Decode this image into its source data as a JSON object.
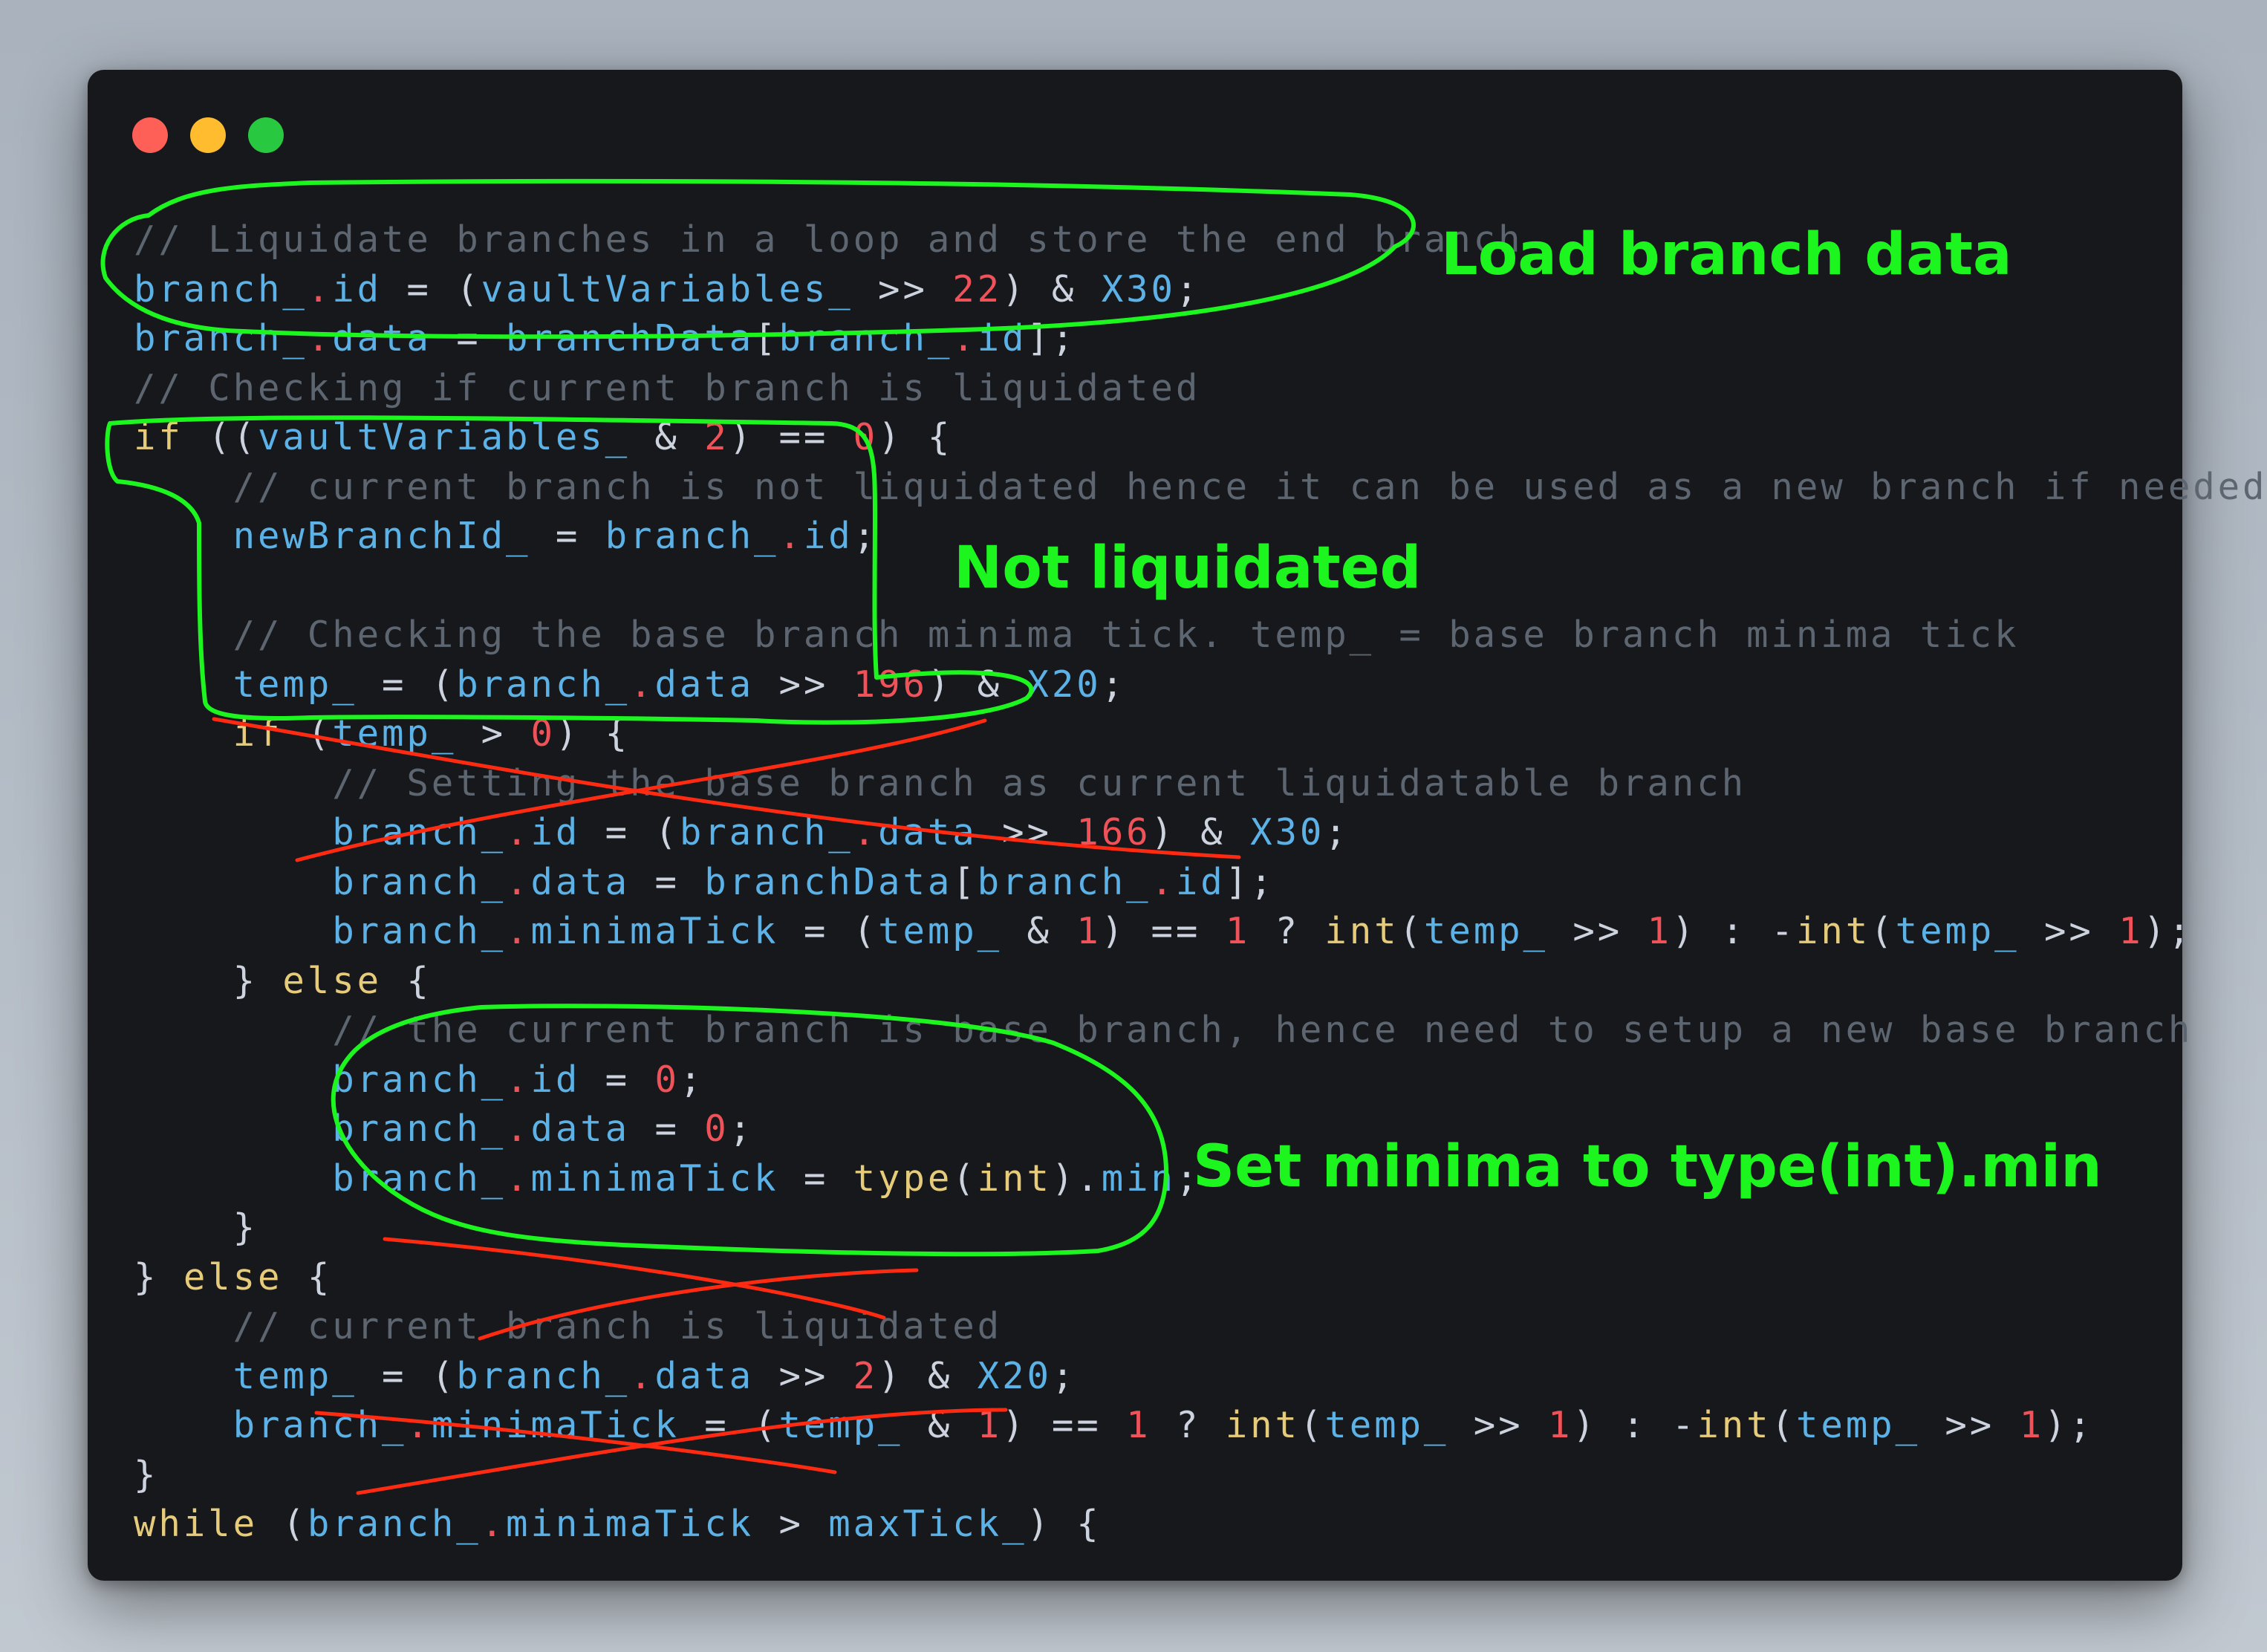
{
  "window": {
    "controls": [
      "close",
      "minimize",
      "maximize"
    ],
    "colors": {
      "close": "#fe5f57",
      "minimize": "#febc2e",
      "maximize": "#28c840"
    }
  },
  "code_lines": [
    [
      {
        "t": "// Liquidate branches in a loop and store the end branch",
        "c": "cm"
      }
    ],
    [
      {
        "t": "branch_",
        "c": "vr"
      },
      {
        "t": ".",
        "c": "nm"
      },
      {
        "t": "id",
        "c": "vr"
      },
      {
        "t": " = (",
        "c": "op"
      },
      {
        "t": "vaultVariables_",
        "c": "vr"
      },
      {
        "t": " >> ",
        "c": "op"
      },
      {
        "t": "22",
        "c": "nm"
      },
      {
        "t": ") & ",
        "c": "op"
      },
      {
        "t": "X30",
        "c": "vr"
      },
      {
        "t": ";",
        "c": "op"
      }
    ],
    [
      {
        "t": "branch_",
        "c": "vr"
      },
      {
        "t": ".",
        "c": "nm"
      },
      {
        "t": "data",
        "c": "vr"
      },
      {
        "t": " = ",
        "c": "op"
      },
      {
        "t": "branchData",
        "c": "vr"
      },
      {
        "t": "[",
        "c": "op"
      },
      {
        "t": "branch_",
        "c": "vr"
      },
      {
        "t": ".",
        "c": "nm"
      },
      {
        "t": "id",
        "c": "vr"
      },
      {
        "t": "];",
        "c": "op"
      }
    ],
    [
      {
        "t": "// Checking if current branch is liquidated",
        "c": "cm"
      }
    ],
    [
      {
        "t": "if",
        "c": "kw"
      },
      {
        "t": " ((",
        "c": "op"
      },
      {
        "t": "vaultVariables_",
        "c": "vr"
      },
      {
        "t": " & ",
        "c": "op"
      },
      {
        "t": "2",
        "c": "nm"
      },
      {
        "t": ") == ",
        "c": "op"
      },
      {
        "t": "0",
        "c": "nm"
      },
      {
        "t": ") {",
        "c": "op"
      }
    ],
    [
      {
        "t": "    // current branch is not liquidated hence it can be used as a new branch if needed",
        "c": "cm"
      }
    ],
    [
      {
        "t": "    ",
        "c": "op"
      },
      {
        "t": "newBranchId_",
        "c": "vr"
      },
      {
        "t": " = ",
        "c": "op"
      },
      {
        "t": "branch_",
        "c": "vr"
      },
      {
        "t": ".",
        "c": "nm"
      },
      {
        "t": "id",
        "c": "vr"
      },
      {
        "t": ";",
        "c": "op"
      }
    ],
    [
      {
        "t": "",
        "c": "op"
      }
    ],
    [
      {
        "t": "    // Checking the base branch minima tick. temp_ = base branch minima tick",
        "c": "cm"
      }
    ],
    [
      {
        "t": "    ",
        "c": "op"
      },
      {
        "t": "temp_",
        "c": "vr"
      },
      {
        "t": " = (",
        "c": "op"
      },
      {
        "t": "branch_",
        "c": "vr"
      },
      {
        "t": ".",
        "c": "nm"
      },
      {
        "t": "data",
        "c": "vr"
      },
      {
        "t": " >> ",
        "c": "op"
      },
      {
        "t": "196",
        "c": "nm"
      },
      {
        "t": ") & ",
        "c": "op"
      },
      {
        "t": "X20",
        "c": "vr"
      },
      {
        "t": ";",
        "c": "op"
      }
    ],
    [
      {
        "t": "    ",
        "c": "op"
      },
      {
        "t": "if",
        "c": "kw"
      },
      {
        "t": " (",
        "c": "op"
      },
      {
        "t": "temp_",
        "c": "vr"
      },
      {
        "t": " > ",
        "c": "op"
      },
      {
        "t": "0",
        "c": "nm"
      },
      {
        "t": ") {",
        "c": "op"
      }
    ],
    [
      {
        "t": "        // Setting the base branch as current liquidatable branch",
        "c": "cm"
      }
    ],
    [
      {
        "t": "        ",
        "c": "op"
      },
      {
        "t": "branch_",
        "c": "vr"
      },
      {
        "t": ".",
        "c": "nm"
      },
      {
        "t": "id",
        "c": "vr"
      },
      {
        "t": " = (",
        "c": "op"
      },
      {
        "t": "branch_",
        "c": "vr"
      },
      {
        "t": ".",
        "c": "nm"
      },
      {
        "t": "data",
        "c": "vr"
      },
      {
        "t": " >> ",
        "c": "op"
      },
      {
        "t": "166",
        "c": "nm"
      },
      {
        "t": ") & ",
        "c": "op"
      },
      {
        "t": "X30",
        "c": "vr"
      },
      {
        "t": ";",
        "c": "op"
      }
    ],
    [
      {
        "t": "        ",
        "c": "op"
      },
      {
        "t": "branch_",
        "c": "vr"
      },
      {
        "t": ".",
        "c": "nm"
      },
      {
        "t": "data",
        "c": "vr"
      },
      {
        "t": " = ",
        "c": "op"
      },
      {
        "t": "branchData",
        "c": "vr"
      },
      {
        "t": "[",
        "c": "op"
      },
      {
        "t": "branch_",
        "c": "vr"
      },
      {
        "t": ".",
        "c": "nm"
      },
      {
        "t": "id",
        "c": "vr"
      },
      {
        "t": "];",
        "c": "op"
      }
    ],
    [
      {
        "t": "        ",
        "c": "op"
      },
      {
        "t": "branch_",
        "c": "vr"
      },
      {
        "t": ".",
        "c": "nm"
      },
      {
        "t": "minimaTick",
        "c": "vr"
      },
      {
        "t": " = (",
        "c": "op"
      },
      {
        "t": "temp_",
        "c": "vr"
      },
      {
        "t": " & ",
        "c": "op"
      },
      {
        "t": "1",
        "c": "nm"
      },
      {
        "t": ") == ",
        "c": "op"
      },
      {
        "t": "1",
        "c": "nm"
      },
      {
        "t": " ? ",
        "c": "op"
      },
      {
        "t": "int",
        "c": "kw"
      },
      {
        "t": "(",
        "c": "op"
      },
      {
        "t": "temp_",
        "c": "vr"
      },
      {
        "t": " >> ",
        "c": "op"
      },
      {
        "t": "1",
        "c": "nm"
      },
      {
        "t": ") : -",
        "c": "op"
      },
      {
        "t": "int",
        "c": "kw"
      },
      {
        "t": "(",
        "c": "op"
      },
      {
        "t": "temp_",
        "c": "vr"
      },
      {
        "t": " >> ",
        "c": "op"
      },
      {
        "t": "1",
        "c": "nm"
      },
      {
        "t": ");",
        "c": "op"
      }
    ],
    [
      {
        "t": "    } ",
        "c": "op"
      },
      {
        "t": "else",
        "c": "kw"
      },
      {
        "t": " {",
        "c": "op"
      }
    ],
    [
      {
        "t": "        // the current branch is base branch, hence need to setup a new base branch",
        "c": "cm"
      }
    ],
    [
      {
        "t": "        ",
        "c": "op"
      },
      {
        "t": "branch_",
        "c": "vr"
      },
      {
        "t": ".",
        "c": "nm"
      },
      {
        "t": "id",
        "c": "vr"
      },
      {
        "t": " = ",
        "c": "op"
      },
      {
        "t": "0",
        "c": "nm"
      },
      {
        "t": ";",
        "c": "op"
      }
    ],
    [
      {
        "t": "        ",
        "c": "op"
      },
      {
        "t": "branch_",
        "c": "vr"
      },
      {
        "t": ".",
        "c": "nm"
      },
      {
        "t": "data",
        "c": "vr"
      },
      {
        "t": " = ",
        "c": "op"
      },
      {
        "t": "0",
        "c": "nm"
      },
      {
        "t": ";",
        "c": "op"
      }
    ],
    [
      {
        "t": "        ",
        "c": "op"
      },
      {
        "t": "branch_",
        "c": "vr"
      },
      {
        "t": ".",
        "c": "nm"
      },
      {
        "t": "minimaTick",
        "c": "vr"
      },
      {
        "t": " = ",
        "c": "op"
      },
      {
        "t": "type",
        "c": "kw"
      },
      {
        "t": "(",
        "c": "op"
      },
      {
        "t": "int",
        "c": "kw"
      },
      {
        "t": ").",
        "c": "op"
      },
      {
        "t": "min",
        "c": "vr"
      },
      {
        "t": ";",
        "c": "op"
      }
    ],
    [
      {
        "t": "    }",
        "c": "op"
      }
    ],
    [
      {
        "t": "} ",
        "c": "op"
      },
      {
        "t": "else",
        "c": "kw"
      },
      {
        "t": " {",
        "c": "op"
      }
    ],
    [
      {
        "t": "    // current branch is liquidated",
        "c": "cm"
      }
    ],
    [
      {
        "t": "    ",
        "c": "op"
      },
      {
        "t": "temp_",
        "c": "vr"
      },
      {
        "t": " = (",
        "c": "op"
      },
      {
        "t": "branch_",
        "c": "vr"
      },
      {
        "t": ".",
        "c": "nm"
      },
      {
        "t": "data",
        "c": "vr"
      },
      {
        "t": " >> ",
        "c": "op"
      },
      {
        "t": "2",
        "c": "nm"
      },
      {
        "t": ") & ",
        "c": "op"
      },
      {
        "t": "X20",
        "c": "vr"
      },
      {
        "t": ";",
        "c": "op"
      }
    ],
    [
      {
        "t": "    ",
        "c": "op"
      },
      {
        "t": "branch_",
        "c": "vr"
      },
      {
        "t": ".",
        "c": "nm"
      },
      {
        "t": "minimaTick",
        "c": "vr"
      },
      {
        "t": " = (",
        "c": "op"
      },
      {
        "t": "temp_",
        "c": "vr"
      },
      {
        "t": " & ",
        "c": "op"
      },
      {
        "t": "1",
        "c": "nm"
      },
      {
        "t": ") == ",
        "c": "op"
      },
      {
        "t": "1",
        "c": "nm"
      },
      {
        "t": " ? ",
        "c": "op"
      },
      {
        "t": "int",
        "c": "kw"
      },
      {
        "t": "(",
        "c": "op"
      },
      {
        "t": "temp_",
        "c": "vr"
      },
      {
        "t": " >> ",
        "c": "op"
      },
      {
        "t": "1",
        "c": "nm"
      },
      {
        "t": ") : -",
        "c": "op"
      },
      {
        "t": "int",
        "c": "kw"
      },
      {
        "t": "(",
        "c": "op"
      },
      {
        "t": "temp_",
        "c": "vr"
      },
      {
        "t": " >> ",
        "c": "op"
      },
      {
        "t": "1",
        "c": "nm"
      },
      {
        "t": ");",
        "c": "op"
      }
    ],
    [
      {
        "t": "}",
        "c": "op"
      }
    ],
    [
      {
        "t": "while",
        "c": "kw"
      },
      {
        "t": " (",
        "c": "op"
      },
      {
        "t": "branch_",
        "c": "vr"
      },
      {
        "t": ".",
        "c": "nm"
      },
      {
        "t": "minimaTick",
        "c": "vr"
      },
      {
        "t": " > ",
        "c": "op"
      },
      {
        "t": "maxTick_",
        "c": "vr"
      },
      {
        "t": ") {",
        "c": "op"
      }
    ]
  ],
  "annotations": {
    "load": "Load branch data",
    "not_liquidated": "Not liquidated",
    "set_minima": "Set minima to type(int).min"
  },
  "colors": {
    "annotation_green": "#1df51f",
    "strike_red": "#ff2a12",
    "background": "#16181b"
  }
}
